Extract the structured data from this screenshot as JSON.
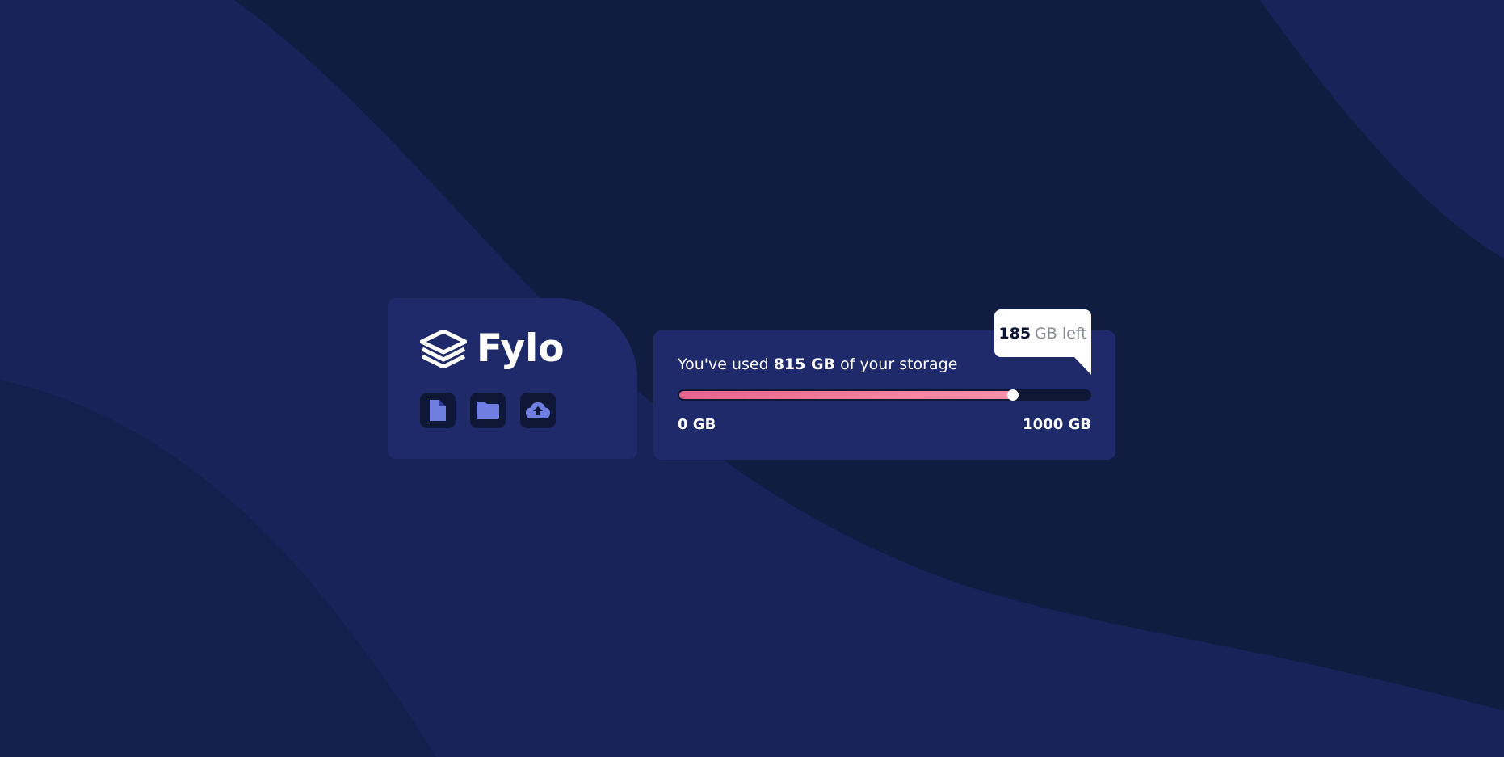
{
  "brand": {
    "name": "Fylo",
    "logo_icon": "layers-icon"
  },
  "actions": [
    {
      "icon": "document-icon",
      "label": "Documents"
    },
    {
      "icon": "folder-icon",
      "label": "Folders"
    },
    {
      "icon": "upload-icon",
      "label": "Upload"
    }
  ],
  "storage": {
    "prefix": "You've used ",
    "used": "815 GB",
    "suffix": " of your storage",
    "used_fraction": 0.815,
    "min_label": "0 GB",
    "max_label": "1000 GB",
    "remaining_number": "185",
    "remaining_unit": "GB left"
  },
  "colors": {
    "background": "#111c41",
    "card": "#1f2a6a",
    "track": "#0f1737",
    "gradient_start": "#e8648c",
    "gradient_end": "#fb93a8",
    "icon_accent": "#6f7ee0"
  }
}
